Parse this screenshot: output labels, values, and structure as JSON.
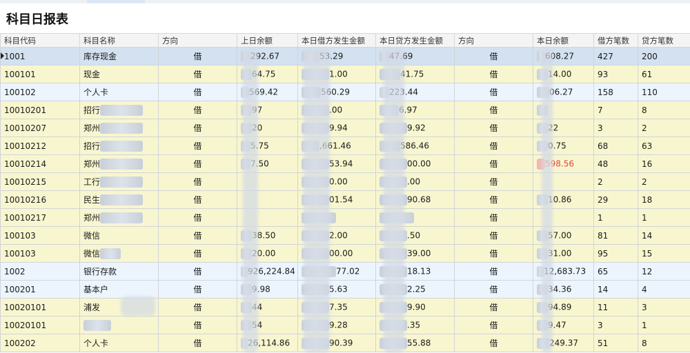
{
  "page_title": "科目日报表",
  "columns": [
    "科目代码",
    "科目名称",
    "方向",
    "上日余额",
    "本日借方发生金额",
    "本日贷方发生金额",
    "方向",
    "本日余额",
    "借方笔数",
    "贷方笔数"
  ],
  "rows": [
    {
      "code": "1001",
      "name": "库存现金",
      "dir1": "借",
      "prev_balance": "292.67",
      "debit_amount": "53.29",
      "credit_amount": "47.69",
      "dir2": "借",
      "balance": "608.27",
      "debit_count": "427",
      "credit_count": "200"
    },
    {
      "code": "100101",
      "name": "现金",
      "dir1": "借",
      "prev_balance": "64.75",
      "debit_amount": "1.00",
      "credit_amount": "41.75",
      "dir2": "借",
      "balance": "14.00",
      "debit_count": "93",
      "credit_count": "61"
    },
    {
      "code": "100102",
      "name": "个人卡",
      "dir1": "借",
      "prev_balance": "569.42",
      "debit_amount": "560.29",
      "credit_amount": "223.44",
      "dir2": "借",
      "balance": "06.27",
      "debit_count": "158",
      "credit_count": "110"
    },
    {
      "code": "10010201",
      "name": "招行",
      "dir1": "借",
      "prev_balance": "97",
      "debit_amount": ".00",
      "credit_amount": "6.97",
      "dir2": "借",
      "balance": "",
      "debit_count": "7",
      "credit_count": "8"
    },
    {
      "code": "10010207",
      "name": "郑州",
      "dir1": "借",
      "prev_balance": "20",
      "debit_amount": "9.94",
      "credit_amount": "9.92",
      "dir2": "借",
      "balance": "22",
      "debit_count": "3",
      "credit_count": "2"
    },
    {
      "code": "10010212",
      "name": "招行",
      "dir1": "借",
      "prev_balance": "5.75",
      "debit_amount": ",661.46",
      "credit_amount": "586.46",
      "dir2": "借",
      "balance": "0.75",
      "debit_count": "68",
      "credit_count": "63"
    },
    {
      "code": "10010214",
      "name": "郑州",
      "dir1": "借",
      "prev_balance": "7.50",
      "debit_amount": "53.94",
      "credit_amount": "00.00",
      "dir2": "借",
      "balance": "598.56",
      "debit_count": "48",
      "credit_count": "16"
    },
    {
      "code": "10010215",
      "name": "工行",
      "dir1": "借",
      "prev_balance": "",
      "debit_amount": "0.00",
      "credit_amount": ".00",
      "dir2": "借",
      "balance": "",
      "debit_count": "2",
      "credit_count": "2"
    },
    {
      "code": "10010216",
      "name": "民生",
      "dir1": "借",
      "prev_balance": "",
      "debit_amount": "01.54",
      "credit_amount": "90.68",
      "dir2": "借",
      "balance": "10.86",
      "debit_count": "29",
      "credit_count": "18"
    },
    {
      "code": "10010217",
      "name": "郑州",
      "dir1": "借",
      "prev_balance": "",
      "debit_amount": "",
      "credit_amount": "",
      "dir2": "借",
      "balance": "",
      "debit_count": "1",
      "credit_count": "1"
    },
    {
      "code": "100103",
      "name": "微信",
      "dir1": "借",
      "prev_balance": "38.50",
      "debit_amount": "2.00",
      "credit_amount": ".50",
      "dir2": "借",
      "balance": "57.00",
      "debit_count": "81",
      "credit_count": "14"
    },
    {
      "code": "100103",
      "name": "微信",
      "dir1": "借",
      "prev_balance": "20.00",
      "debit_amount": "00.00",
      "credit_amount": "39.00",
      "dir2": "借",
      "balance": "31.00",
      "debit_count": "95",
      "credit_count": "15"
    },
    {
      "code": "1002",
      "name": "银行存款",
      "dir1": "借",
      "prev_balance": "926,224.84",
      "debit_amount": "77.02",
      "credit_amount": "18.13",
      "dir2": "借",
      "balance": "12,683.73",
      "debit_count": "65",
      "credit_count": "12"
    },
    {
      "code": "100201",
      "name": "基本户",
      "dir1": "借",
      "prev_balance": "9.98",
      "debit_amount": "5.63",
      "credit_amount": "2.25",
      "dir2": "借",
      "balance": "34.36",
      "debit_count": "14",
      "credit_count": "4"
    },
    {
      "code": "100201​01",
      "name": "浦发",
      "dir1": "借",
      "prev_balance": "44",
      "debit_amount": "7.35",
      "credit_amount": "9.90",
      "dir2": "借",
      "balance": "94.89",
      "debit_count": "11",
      "credit_count": "3"
    },
    {
      "code": "100201​01",
      "name": "",
      "dir1": "借",
      "prev_balance": "54",
      "debit_amount": "9.28",
      "credit_amount": ".35",
      "dir2": "借",
      "balance": "9.47",
      "debit_count": "3",
      "credit_count": "1"
    },
    {
      "code": "100202",
      "name": "个人卡",
      "dir1": "借",
      "prev_balance": "26,114.86",
      "debit_amount": "90.39",
      "credit_amount": "55.88",
      "dir2": "借",
      "balance": "249.37",
      "debit_count": "51",
      "credit_count": "8"
    }
  ],
  "colors": {
    "row_yellow": "#f8f6cf",
    "row_blue": "#ecf5fe",
    "row_selected": "#d3e1f0",
    "negative_text": "#e8433a"
  }
}
